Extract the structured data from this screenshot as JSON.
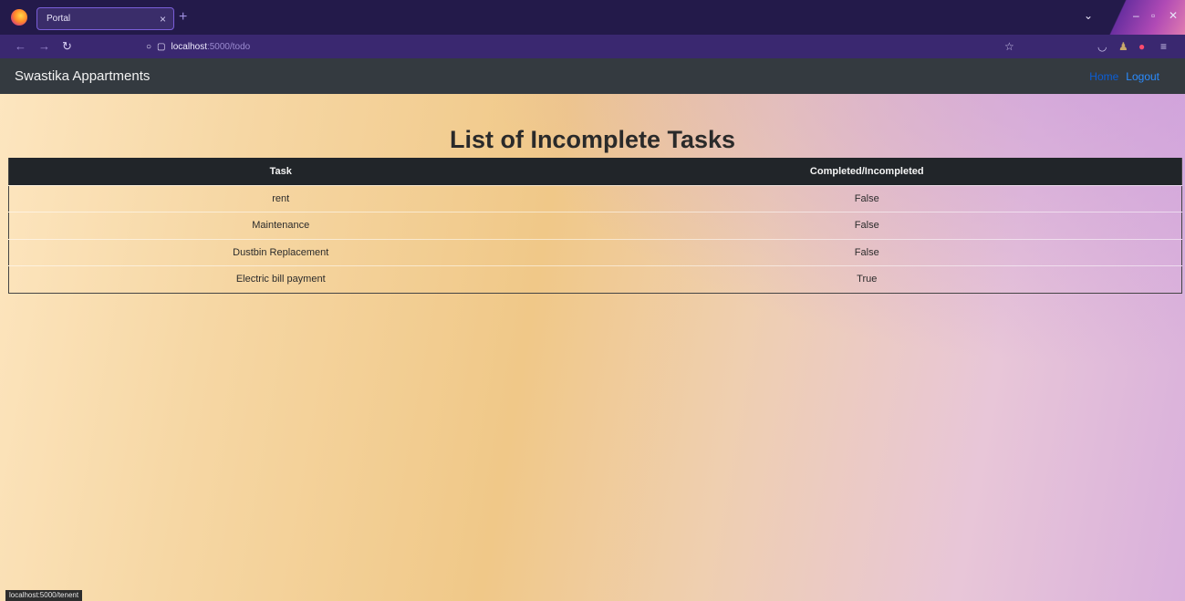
{
  "browser": {
    "tab_title": "Portal",
    "tab_close": "×",
    "new_tab": "+",
    "url_host": "localhost",
    "url_path": ":5000/todo",
    "status_url": "localhost:5000/tenent"
  },
  "navbar": {
    "brand": "Swastika Appartments",
    "links": {
      "home": "Home",
      "logout": "Logout"
    }
  },
  "page": {
    "title": "List of Incomplete Tasks"
  },
  "table": {
    "headers": [
      "Task",
      "Completed/Incompleted"
    ],
    "rows": [
      [
        "rent",
        "False"
      ],
      [
        "Maintenance",
        "False"
      ],
      [
        "Dustbin Replacement",
        "False"
      ],
      [
        "Electric bill payment",
        "True"
      ]
    ]
  },
  "colors": {
    "navbar_bg": "#343a40",
    "table_header_bg": "#212529",
    "link_blue": "#0b5ed7"
  }
}
